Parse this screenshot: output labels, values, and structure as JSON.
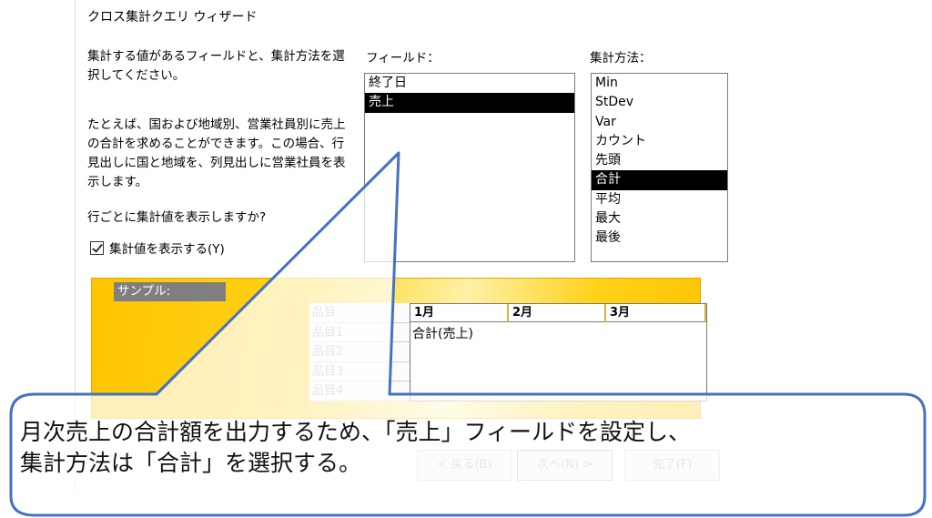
{
  "dialog": {
    "title": "クロス集計クエリ ウィザード",
    "instruction": "集計する値があるフィールドと、集計方法を選択してください。",
    "example": "たとえば、国および地域別、営業社員別に売上の合計を求めることができます。この場合、行見出しに国と地域を、列見出しに営業社員を表示します。",
    "question": "行ごとに集計値を表示しますか?",
    "checkbox_label": "集計値を表示する(Y)",
    "checkbox_checked": true
  },
  "fields": {
    "label": "フィールド：",
    "items": [
      "終了日",
      "売上"
    ],
    "selected": "売上"
  },
  "methods": {
    "label": "集計方法：",
    "items": [
      "Min",
      "StDev",
      "Var",
      "カウント",
      "先頭",
      "合計",
      "平均",
      "最大",
      "最後"
    ],
    "selected": "合計"
  },
  "sample": {
    "label": "サンプル:",
    "row_header": "品目",
    "rows": [
      "品目1",
      "品目2",
      "品目3",
      "品目4"
    ],
    "columns": [
      "1月",
      "2月",
      "3月"
    ],
    "cell": "合計(売上)"
  },
  "buttons": {
    "back": "< 戻る(B)",
    "next": "次へ(N) >",
    "finish": "完了(F)"
  },
  "callout": {
    "line1": "月次売上の合計額を出力するため、「売上」フィールドを設定し、",
    "line2": "集計方法は「合計」を選択する。"
  },
  "colors": {
    "callout_border": "#4472c4",
    "sample_gold": "#ffc400",
    "selection": "#000000"
  }
}
